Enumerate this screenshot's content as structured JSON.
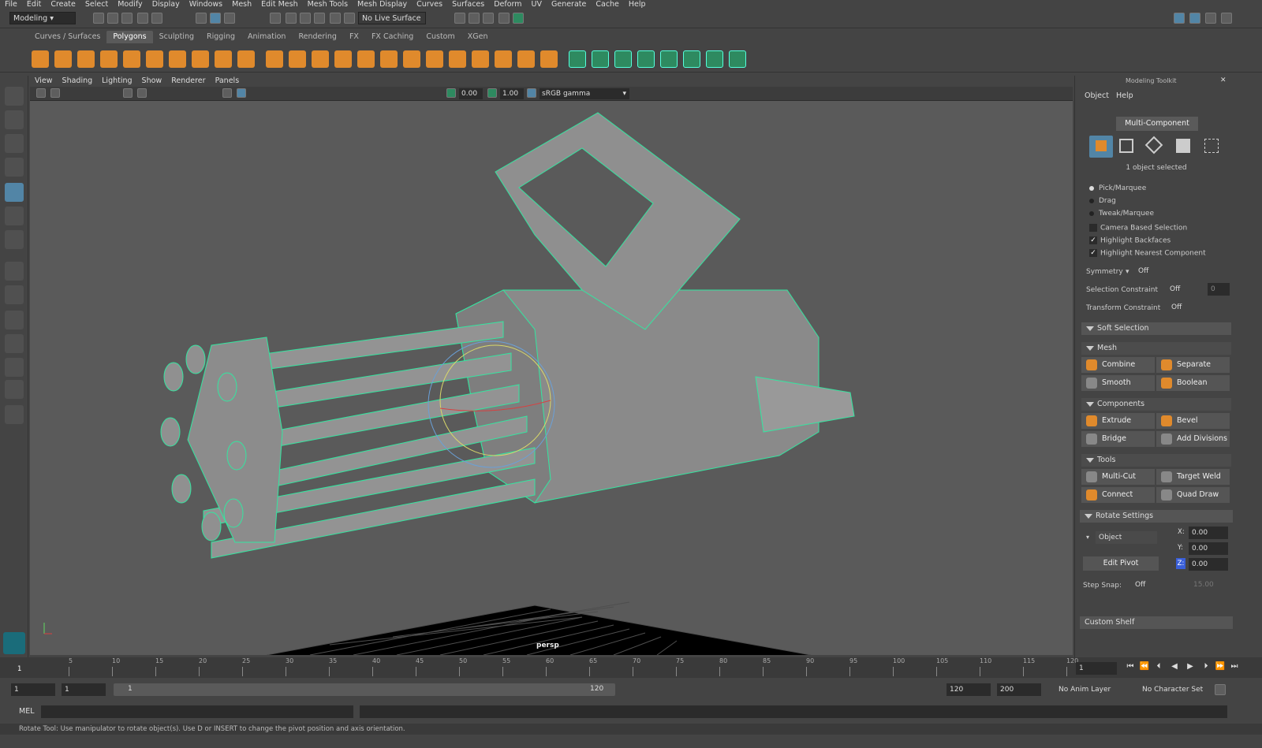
{
  "menubar": [
    "File",
    "Edit",
    "Create",
    "Select",
    "Modify",
    "Display",
    "Windows",
    "Mesh",
    "Edit Mesh",
    "Mesh Tools",
    "Mesh Display",
    "Curves",
    "Surfaces",
    "Deform",
    "UV",
    "Generate",
    "Cache",
    "Help"
  ],
  "status": {
    "workspace": "Modeling",
    "live_surface": "No Live Surface"
  },
  "shelf_tabs": [
    "Curves / Surfaces",
    "Polygons",
    "Sculpting",
    "Rigging",
    "Animation",
    "Rendering",
    "FX",
    "FX Caching",
    "Custom",
    "XGen"
  ],
  "shelf_active": "Polygons",
  "viewport": {
    "menu": [
      "View",
      "Shading",
      "Lighting",
      "Show",
      "Renderer",
      "Panels"
    ],
    "exposure": "0.00",
    "gamma": "1.00",
    "colorspace": "sRGB gamma",
    "camera": "persp"
  },
  "toolkit": {
    "title": "Modeling Toolkit",
    "menu": [
      "Object",
      "Help"
    ],
    "mode": "Multi-Component",
    "selected": "1 object selected",
    "pick_options": [
      "Pick/Marquee",
      "Drag",
      "Tweak/Marquee"
    ],
    "checks": [
      {
        "label": "Camera Based Selection",
        "on": false
      },
      {
        "label": "Highlight Backfaces",
        "on": true
      },
      {
        "label": "Highlight Nearest Component",
        "on": true
      }
    ],
    "symmetry_label": "Symmetry",
    "symmetry_value": "Off",
    "sel_constraint_label": "Selection Constraint",
    "sel_constraint_value": "Off",
    "sel_constraint_num": "0",
    "xf_constraint_label": "Transform Constraint",
    "xf_constraint_value": "Off",
    "soft_selection": "Soft Selection",
    "mesh_header": "Mesh",
    "mesh_buttons": [
      "Combine",
      "Separate",
      "Smooth",
      "Boolean"
    ],
    "components_header": "Components",
    "component_buttons": [
      "Extrude",
      "Bevel",
      "Bridge",
      "Add Divisions"
    ],
    "tools_header": "Tools",
    "tool_buttons": [
      "Multi-Cut",
      "Target Weld",
      "Connect",
      "Quad Draw"
    ],
    "rotate_header": "Rotate Settings",
    "rotate_space": "Object",
    "edit_pivot": "Edit Pivot",
    "x_label": "X:",
    "x": "0.00",
    "y_label": "Y:",
    "y": "0.00",
    "z_label": "Z:",
    "z": "0.00",
    "step_snap_label": "Step Snap:",
    "step_snap_value": "Off",
    "step_snap_num": "15.00",
    "custom_shelf": "Custom Shelf"
  },
  "timeline": {
    "ticks": [
      "5",
      "10",
      "15",
      "20",
      "25",
      "30",
      "35",
      "40",
      "45",
      "50",
      "55",
      "60",
      "65",
      "70",
      "75",
      "80",
      "85",
      "90",
      "95",
      "100",
      "105",
      "110",
      "115",
      "120"
    ],
    "start_tick": "1",
    "current": "1"
  },
  "range": {
    "start": "1",
    "play_start": "1",
    "slider_start": "1",
    "slider_end": "120",
    "play_end": "120",
    "end": "200",
    "anim_layer": "No Anim Layer",
    "char_set": "No Character Set"
  },
  "cmd": {
    "label": "MEL"
  },
  "help_line": "Rotate Tool: Use manipulator to rotate object(s). Use D or INSERT to change the pivot position and axis orientation."
}
